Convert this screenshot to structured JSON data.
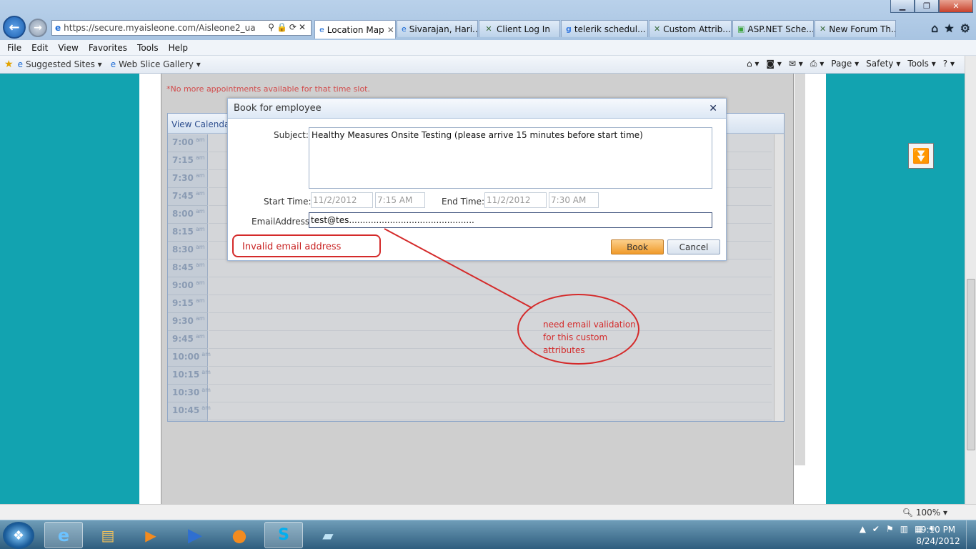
{
  "browser": {
    "address": "https://secure.myaisleone.com/Aisleone2_ua",
    "tabs": [
      {
        "icon": "ie-page-icon",
        "label": "Location Map",
        "active": true
      },
      {
        "icon": "ie-page-icon",
        "label": "Sivarajan, Hari..."
      },
      {
        "icon": "x-logo-icon",
        "label": "Client Log In"
      },
      {
        "icon": "google-icon",
        "label": "telerik schedul..."
      },
      {
        "icon": "x-logo-icon",
        "label": "Custom Attrib..."
      },
      {
        "icon": "green-page-icon",
        "label": "ASP.NET Sche..."
      },
      {
        "icon": "x-logo-icon",
        "label": "New Forum Th..."
      }
    ],
    "menu": [
      "File",
      "Edit",
      "View",
      "Favorites",
      "Tools",
      "Help"
    ],
    "favorites": [
      {
        "label": "Suggested Sites ▾"
      },
      {
        "label": "Web Slice Gallery ▾"
      }
    ],
    "commands": [
      "Page ▾",
      "Safety ▾",
      "Tools ▾",
      "? ▾"
    ]
  },
  "page": {
    "message": "*No more appointments available for that time slot.",
    "view_calendar": "View Calendar",
    "times": [
      "7:00",
      "7:15",
      "7:30",
      "7:45",
      "8:00",
      "8:15",
      "8:30",
      "8:45",
      "9:00",
      "9:15",
      "9:30",
      "9:45",
      "10:00",
      "10:15",
      "10:30",
      "10:45"
    ],
    "am": "am"
  },
  "dialog": {
    "title": "Book for employee",
    "subject_label": "Subject:",
    "subject_value": "Healthy Measures Onsite Testing (please arrive 15 minutes before start time)",
    "start_label": "Start Time:",
    "start_date": "11/2/2012",
    "start_time": "7:15 AM",
    "end_label": "End Time:",
    "end_date": "11/2/2012",
    "end_time": "7:30 AM",
    "email_label": "EmailAddress:",
    "email_value": "test@tes..............................................",
    "error": "Invalid email address",
    "book": "Book",
    "cancel": "Cancel"
  },
  "annotation": {
    "line1": "need email validation",
    "line2": "for this custom",
    "line3": "attributes",
    "color": "#d42a2a"
  },
  "status": {
    "zoom": "100% ▾"
  },
  "taskbar": {
    "time": "9:10 PM",
    "date": "8/24/2012"
  }
}
